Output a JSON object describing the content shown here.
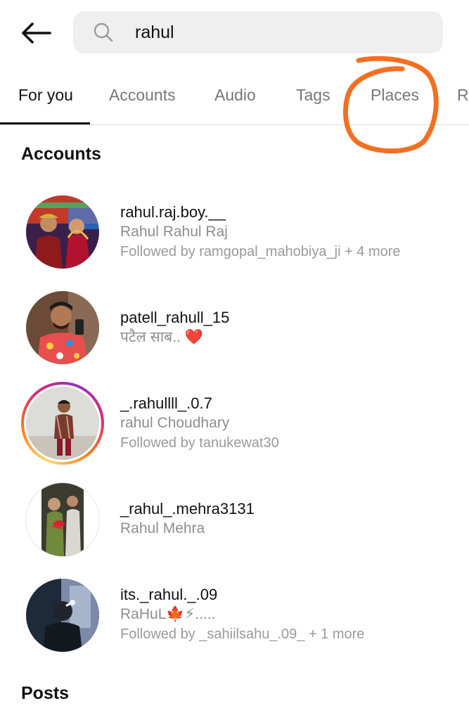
{
  "search": {
    "query": "rahul"
  },
  "tabs": [
    {
      "label": "For you",
      "active": true
    },
    {
      "label": "Accounts",
      "active": false
    },
    {
      "label": "Audio",
      "active": false
    },
    {
      "label": "Tags",
      "active": false
    },
    {
      "label": "Places",
      "active": false
    },
    {
      "label": "Re",
      "active": false
    }
  ],
  "annotation": {
    "color": "#f36f21",
    "target": "Places"
  },
  "accounts_section": {
    "title": "Accounts",
    "items": [
      {
        "username": "rahul.raj.boy.__",
        "full_name": "Rahul Rahul Raj",
        "followed_by": "Followed by ramgopal_mahobiya_ji + 4 more"
      },
      {
        "username": "patell_rahull_15",
        "full_name": "पटैल साब.. ❤️"
      },
      {
        "username": "_.rahullll_.0.7",
        "full_name": "rahul Choudhary",
        "followed_by": "Followed by tanukewat30",
        "has_story": true
      },
      {
        "username": "_rahul_.mehra3131",
        "full_name": "Rahul Mehra"
      },
      {
        "username": "its._rahul._.09",
        "full_name": "RaHuL🍁⚡.....",
        "followed_by": "Followed by _sahiilsahu_.09_ + 1 more"
      }
    ]
  },
  "posts_section": {
    "title": "Posts"
  },
  "colors": {
    "accent_text": "#111111",
    "muted_text": "#8e8e8e",
    "search_bg": "#efefef",
    "divider": "#dbdbdb"
  }
}
